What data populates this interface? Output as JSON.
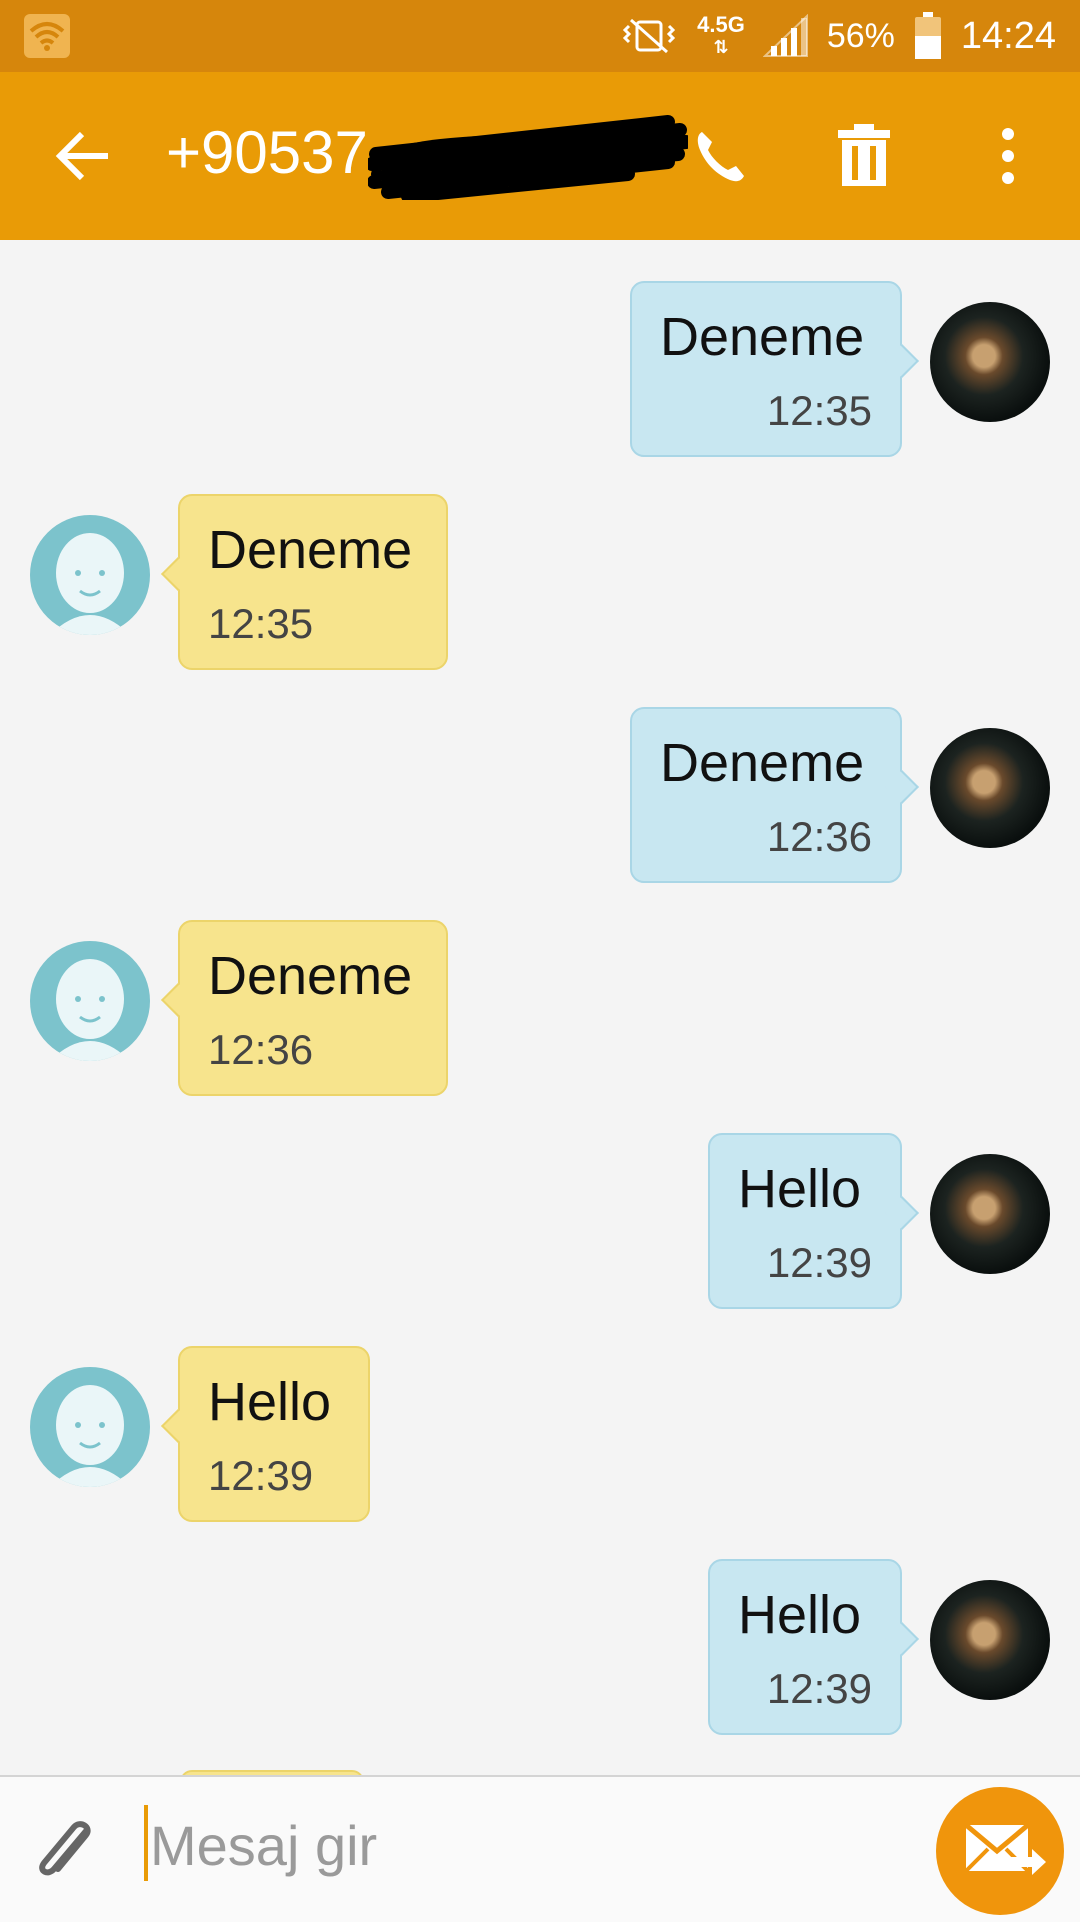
{
  "status_bar": {
    "battery_pct": "56%",
    "time": "14:24",
    "network": "4.5G",
    "icons": [
      "wifi-icon",
      "vibrate-icon",
      "signal-icon",
      "battery-icon"
    ]
  },
  "header": {
    "title": "+90537",
    "icons": [
      "back-arrow-icon",
      "phone-icon",
      "trash-icon",
      "more-vert-icon"
    ]
  },
  "messages": [
    {
      "dir": "out",
      "text": "Deneme",
      "time": "12:35"
    },
    {
      "dir": "in",
      "text": "Deneme",
      "time": "12:35"
    },
    {
      "dir": "out",
      "text": "Deneme",
      "time": "12:36"
    },
    {
      "dir": "in",
      "text": "Deneme",
      "time": "12:36"
    },
    {
      "dir": "out",
      "text": "Hello",
      "time": "12:39"
    },
    {
      "dir": "in",
      "text": "Hello",
      "time": "12:39"
    },
    {
      "dir": "out",
      "text": "Hello",
      "time": "12:39"
    }
  ],
  "composer": {
    "placeholder": "Mesaj gir",
    "icons": [
      "paperclip-icon",
      "send-envelope-icon"
    ]
  },
  "colors": {
    "status_bar": "#d6860c",
    "header": "#e99b06",
    "outgoing_bubble": "#c8e7f1",
    "incoming_bubble": "#f7e48d",
    "send_button": "#f0950c"
  }
}
